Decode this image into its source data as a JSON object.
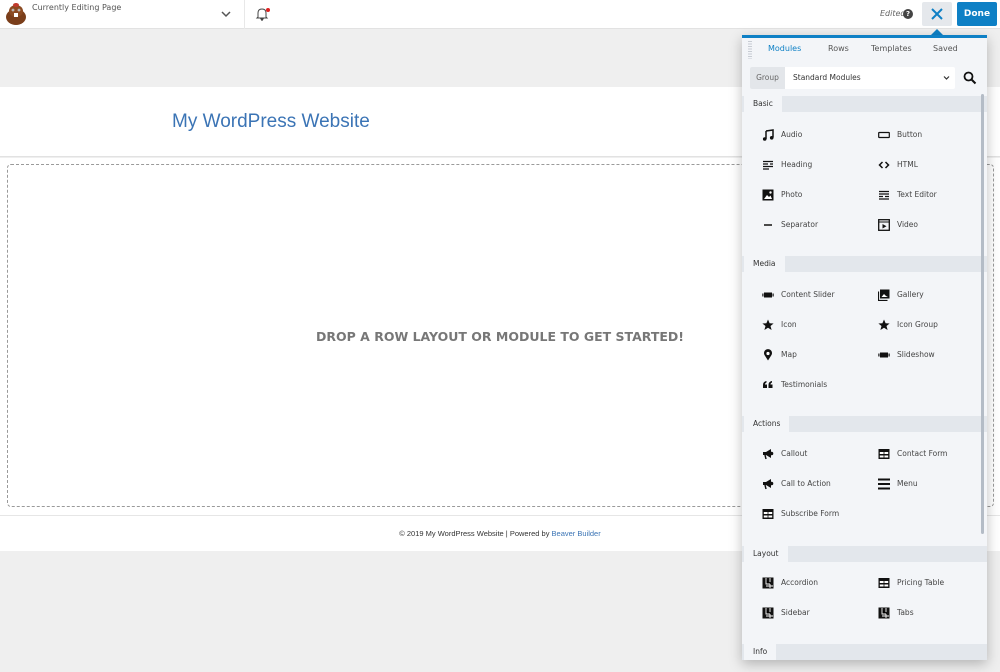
{
  "topbar": {
    "editing_label": "Currently Editing Page",
    "edited_label": "Edited",
    "help_icon": "question-circle-icon",
    "close_icon": "close-x-icon",
    "done_label": "Done",
    "notification_icon": "bell-icon",
    "accent_color": "#0e80c5"
  },
  "page": {
    "site_title": "My WordPress Website",
    "drop_message": "DROP A ROW LAYOUT OR MODULE TO GET STARTED!",
    "footer_text": "© 2019 My WordPress Website | Powered by ",
    "footer_link": "Beaver Builder"
  },
  "panel": {
    "tabs": [
      {
        "label": "Modules",
        "active": true
      },
      {
        "label": "Rows",
        "active": false
      },
      {
        "label": "Templates",
        "active": false
      },
      {
        "label": "Saved",
        "active": false
      }
    ],
    "group_label": "Group",
    "group_selected": "Standard Modules",
    "sections": [
      {
        "title": "Basic",
        "modules": [
          {
            "label": "Audio",
            "icon": "music-note-icon"
          },
          {
            "label": "Button",
            "icon": "button-rect-icon"
          },
          {
            "label": "Heading",
            "icon": "heading-lines-icon"
          },
          {
            "label": "HTML",
            "icon": "code-brackets-icon"
          },
          {
            "label": "Photo",
            "icon": "photo-icon"
          },
          {
            "label": "Text Editor",
            "icon": "text-lines-icon"
          },
          {
            "label": "Separator",
            "icon": "separator-line-icon"
          },
          {
            "label": "Video",
            "icon": "video-play-icon"
          }
        ]
      },
      {
        "title": "Media",
        "modules": [
          {
            "label": "Content Slider",
            "icon": "slider-icon"
          },
          {
            "label": "Gallery",
            "icon": "gallery-icon"
          },
          {
            "label": "Icon",
            "icon": "star-icon"
          },
          {
            "label": "Icon Group",
            "icon": "star-icon"
          },
          {
            "label": "Map",
            "icon": "map-pin-icon"
          },
          {
            "label": "Slideshow",
            "icon": "slider-icon"
          },
          {
            "label": "Testimonials",
            "icon": "quote-icon"
          }
        ]
      },
      {
        "title": "Actions",
        "modules": [
          {
            "label": "Callout",
            "icon": "megaphone-icon"
          },
          {
            "label": "Contact Form",
            "icon": "form-table-icon"
          },
          {
            "label": "Call to Action",
            "icon": "megaphone-icon"
          },
          {
            "label": "Menu",
            "icon": "hamburger-menu-icon"
          },
          {
            "label": "Subscribe Form",
            "icon": "form-table-icon"
          }
        ]
      },
      {
        "title": "Layout",
        "modules": [
          {
            "label": "Accordion",
            "icon": "layout-grid-icon"
          },
          {
            "label": "Pricing Table",
            "icon": "form-table-icon"
          },
          {
            "label": "Sidebar",
            "icon": "layout-grid-icon"
          },
          {
            "label": "Tabs",
            "icon": "layout-grid-icon"
          }
        ]
      },
      {
        "title": "Info",
        "modules": []
      }
    ]
  }
}
